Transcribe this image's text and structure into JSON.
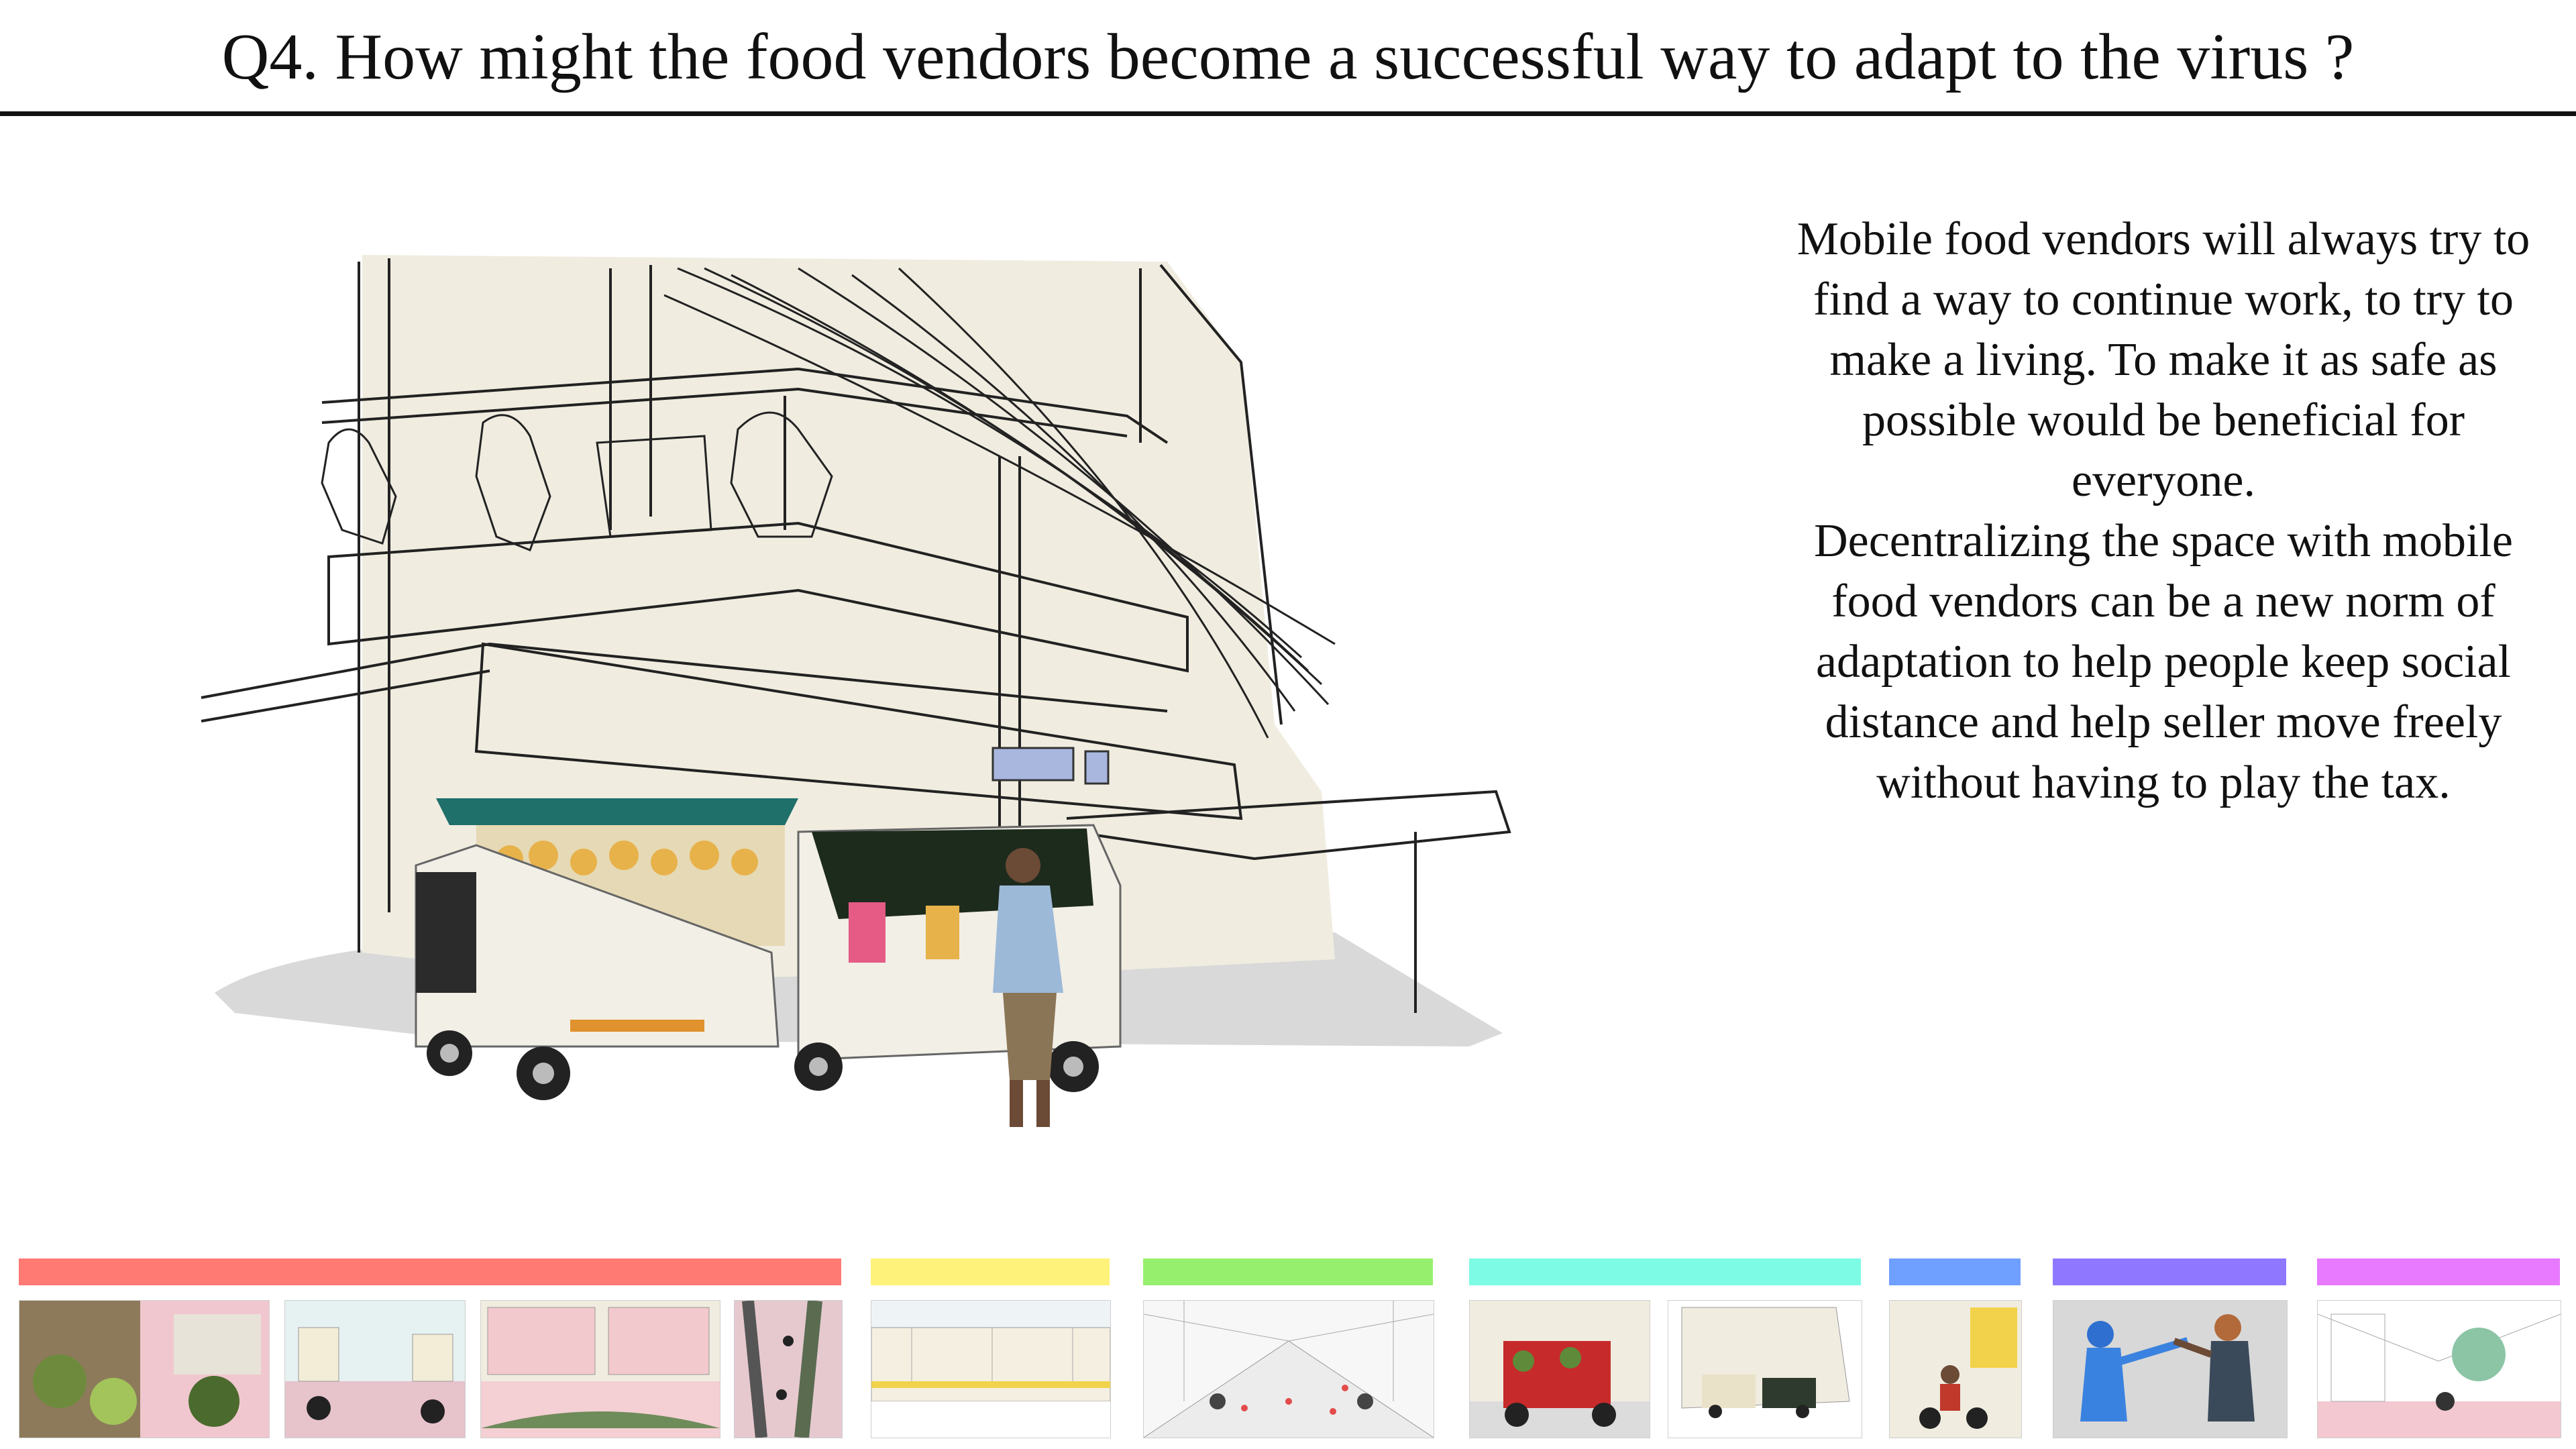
{
  "header": {
    "title": "Q4. How might the food vendors become a successful way to adapt to the virus ?"
  },
  "main": {
    "paragraphs": [
      "Mobile food vendors will always try to find a way to continue work, to try to make a living. To make it as safe as possible would be beneficial for everyone.",
      "Decentralizing the space with mobile food vendors can be a new norm of adaptation to help people keep social distance and help seller move freely without having to play the tax."
    ]
  },
  "illustration": {
    "subject": "sketched street corner building with two tuk-tuk food vendor carts",
    "colors": {
      "wall": "#f0ece0",
      "ground": "#d9d9d9",
      "awning": "#1f6f6a",
      "cart_body": "#f2efe6"
    }
  },
  "timeline": {
    "groups": [
      {
        "color": "#ff7a73",
        "thumbs": [
          "market-scene",
          "street-sketch",
          "pink-facade",
          "aerial-vendors"
        ]
      },
      {
        "color": "#fff27a",
        "thumbs": [
          "market-facade-elevation"
        ]
      },
      {
        "color": "#96f06e",
        "thumbs": [
          "perspective-street-markings"
        ]
      },
      {
        "color": "#7dfbe4",
        "thumbs": [
          "red-cart",
          "corner-carts"
        ]
      },
      {
        "color": "#6f9fff",
        "thumbs": [
          "motorbike-vendor"
        ]
      },
      {
        "color": "#8f78ff",
        "thumbs": [
          "masked-exchange"
        ]
      },
      {
        "color": "#e77aff",
        "thumbs": [
          "street-tree-sketch"
        ]
      }
    ]
  }
}
